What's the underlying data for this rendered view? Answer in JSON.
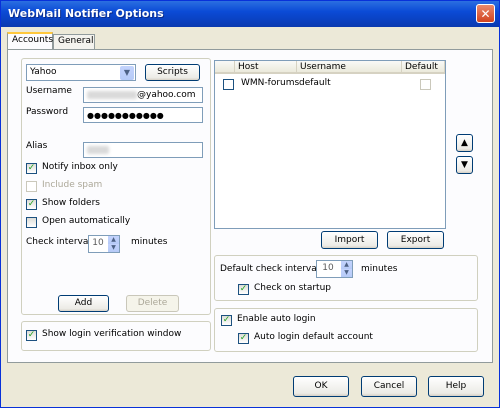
{
  "window": {
    "title": "WebMail Notifier Options",
    "close_label": "✕"
  },
  "tabs": [
    {
      "label": "Accounts"
    },
    {
      "label": "General"
    }
  ],
  "accounts": {
    "provider_select": {
      "value": "Yahoo",
      "arrow": "▼"
    },
    "scripts_label": "Scripts",
    "username_label": "Username",
    "username_suffix": "@yahoo.com",
    "password_label": "Password",
    "password_value": "●●●●●●●●●●●",
    "alias_label": "Alias",
    "notify_inbox_only": {
      "label": "Notify inbox only",
      "checked": true
    },
    "include_spam": {
      "label": "Include spam",
      "checked": false,
      "disabled": true
    },
    "show_folders": {
      "label": "Show folders",
      "checked": true
    },
    "open_automatically": {
      "label": "Open automatically",
      "checked": false
    },
    "check_interval": {
      "label": "Check interval",
      "value": "10",
      "unit": "minutes"
    },
    "add_label": "Add",
    "delete_label": "Delete",
    "show_login_window": {
      "label": "Show login verification window",
      "checked": true
    }
  },
  "account_list": {
    "columns": [
      "Host",
      "Username",
      "Default"
    ],
    "rows": [
      {
        "host": "WMN-forums",
        "username": "default",
        "checked": false,
        "default": false
      }
    ]
  },
  "move_up": "▲",
  "move_down": "▼",
  "import_label": "Import",
  "export_label": "Export",
  "default_check": {
    "label": "Default check interval",
    "value": "10",
    "unit": "minutes"
  },
  "check_on_startup": {
    "label": "Check on startup",
    "checked": true
  },
  "enable_auto_login": {
    "label": "Enable auto login",
    "checked": true
  },
  "auto_login_default": {
    "label": "Auto login default account",
    "checked": true
  },
  "footer": {
    "ok_label": "OK",
    "cancel_label": "Cancel",
    "help_label": "Help"
  },
  "colors": {
    "titlebar": "#0b4bd6",
    "window_bg": "#ece9d8",
    "panel_bg": "#fcfcfe",
    "check": "#21a121"
  }
}
